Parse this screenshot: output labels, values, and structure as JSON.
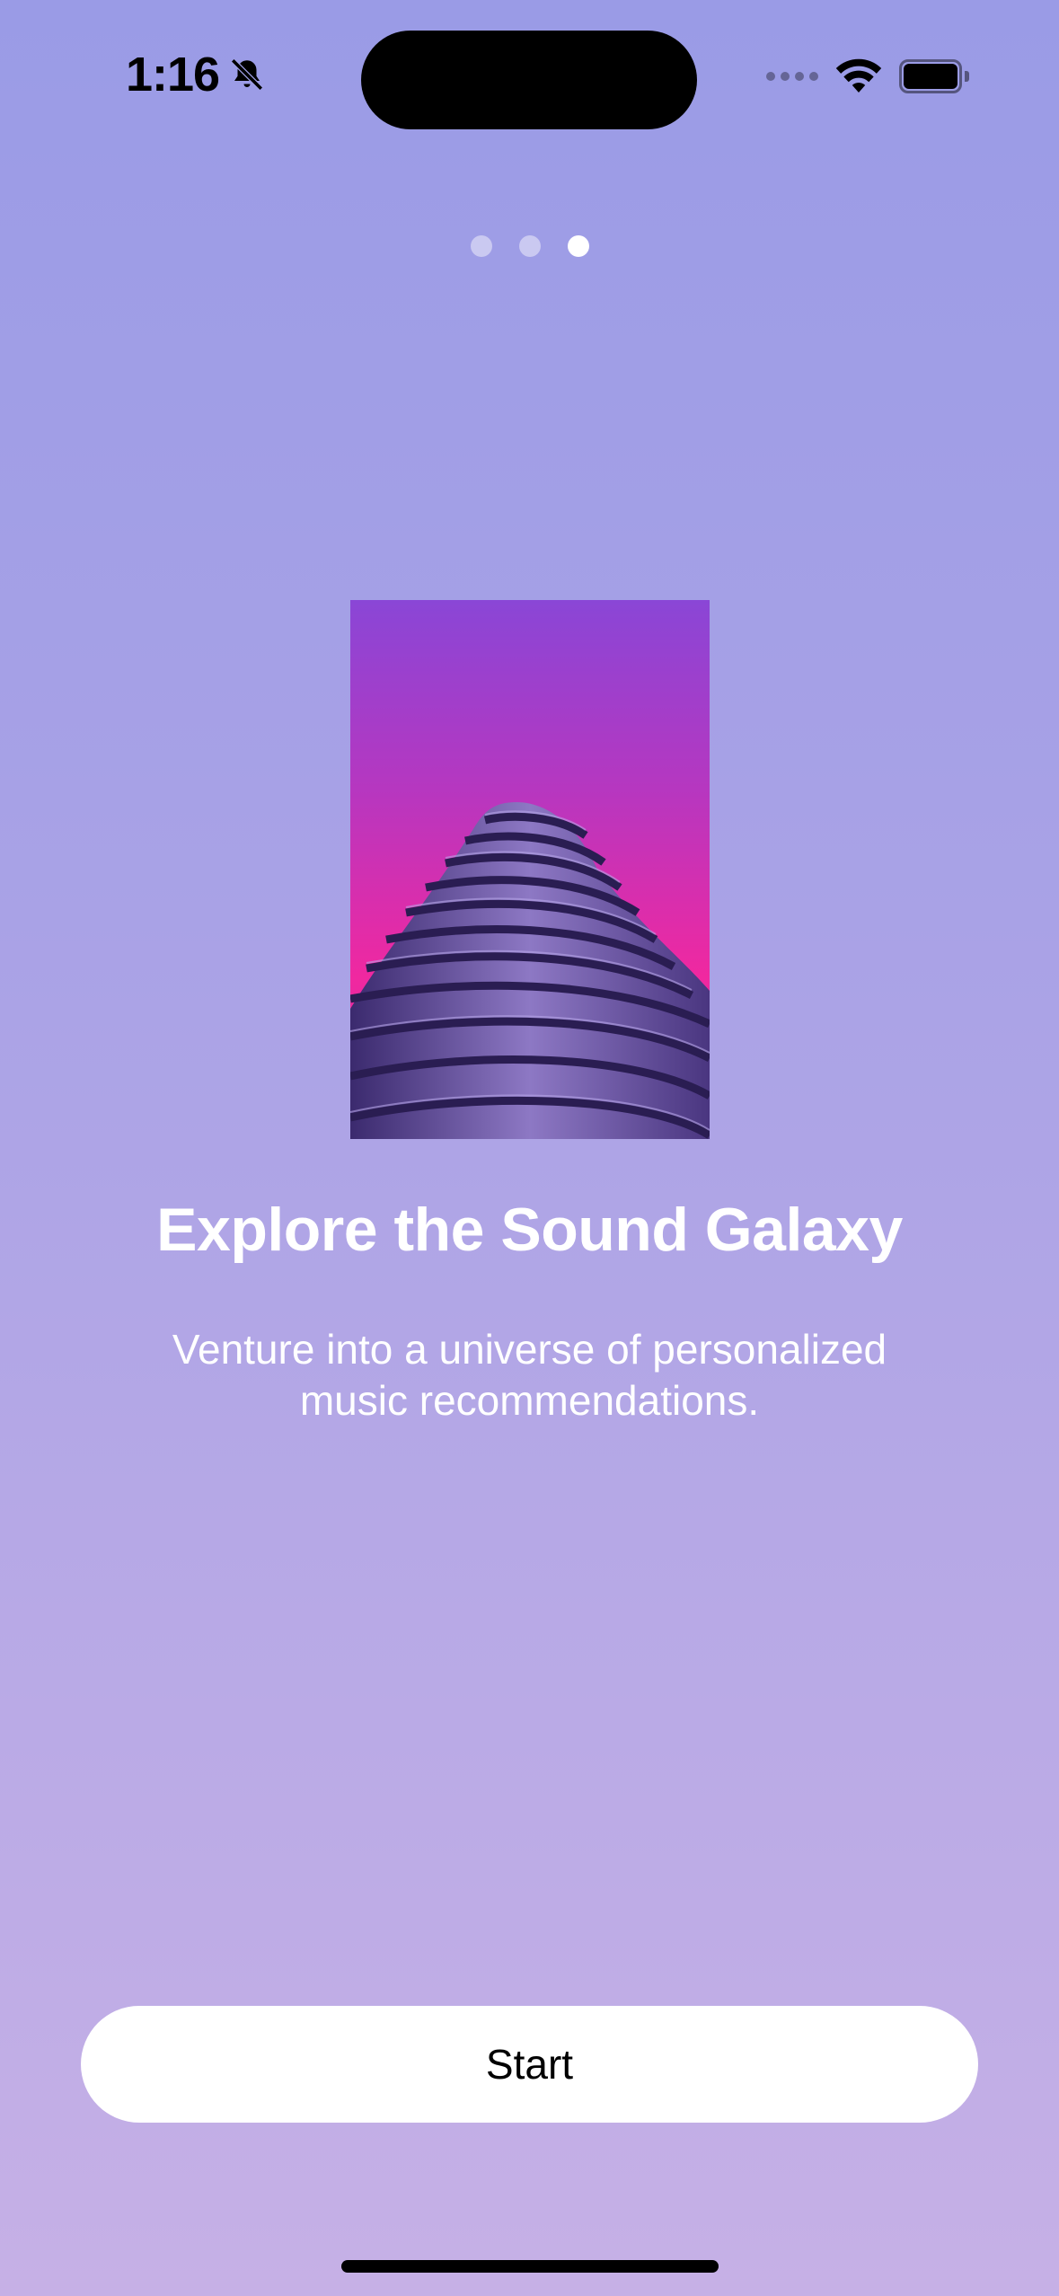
{
  "status_bar": {
    "time": "1:16",
    "icons": [
      "bell-slash-icon",
      "cellular-dots-icon",
      "wifi-icon",
      "battery-icon"
    ]
  },
  "pager": {
    "page_count": 3,
    "active_index": 2
  },
  "hero": {
    "icon": "building-photo"
  },
  "content": {
    "title": "Explore the Sound Galaxy",
    "subtitle": "Venture into a universe of personalized music recommendations."
  },
  "actions": {
    "start_label": "Start"
  },
  "colors": {
    "background_top": "#9a9be6",
    "background_bottom": "#c6b0e6",
    "text": "#ffffff",
    "button_bg": "#ffffff",
    "button_text": "#000000"
  }
}
